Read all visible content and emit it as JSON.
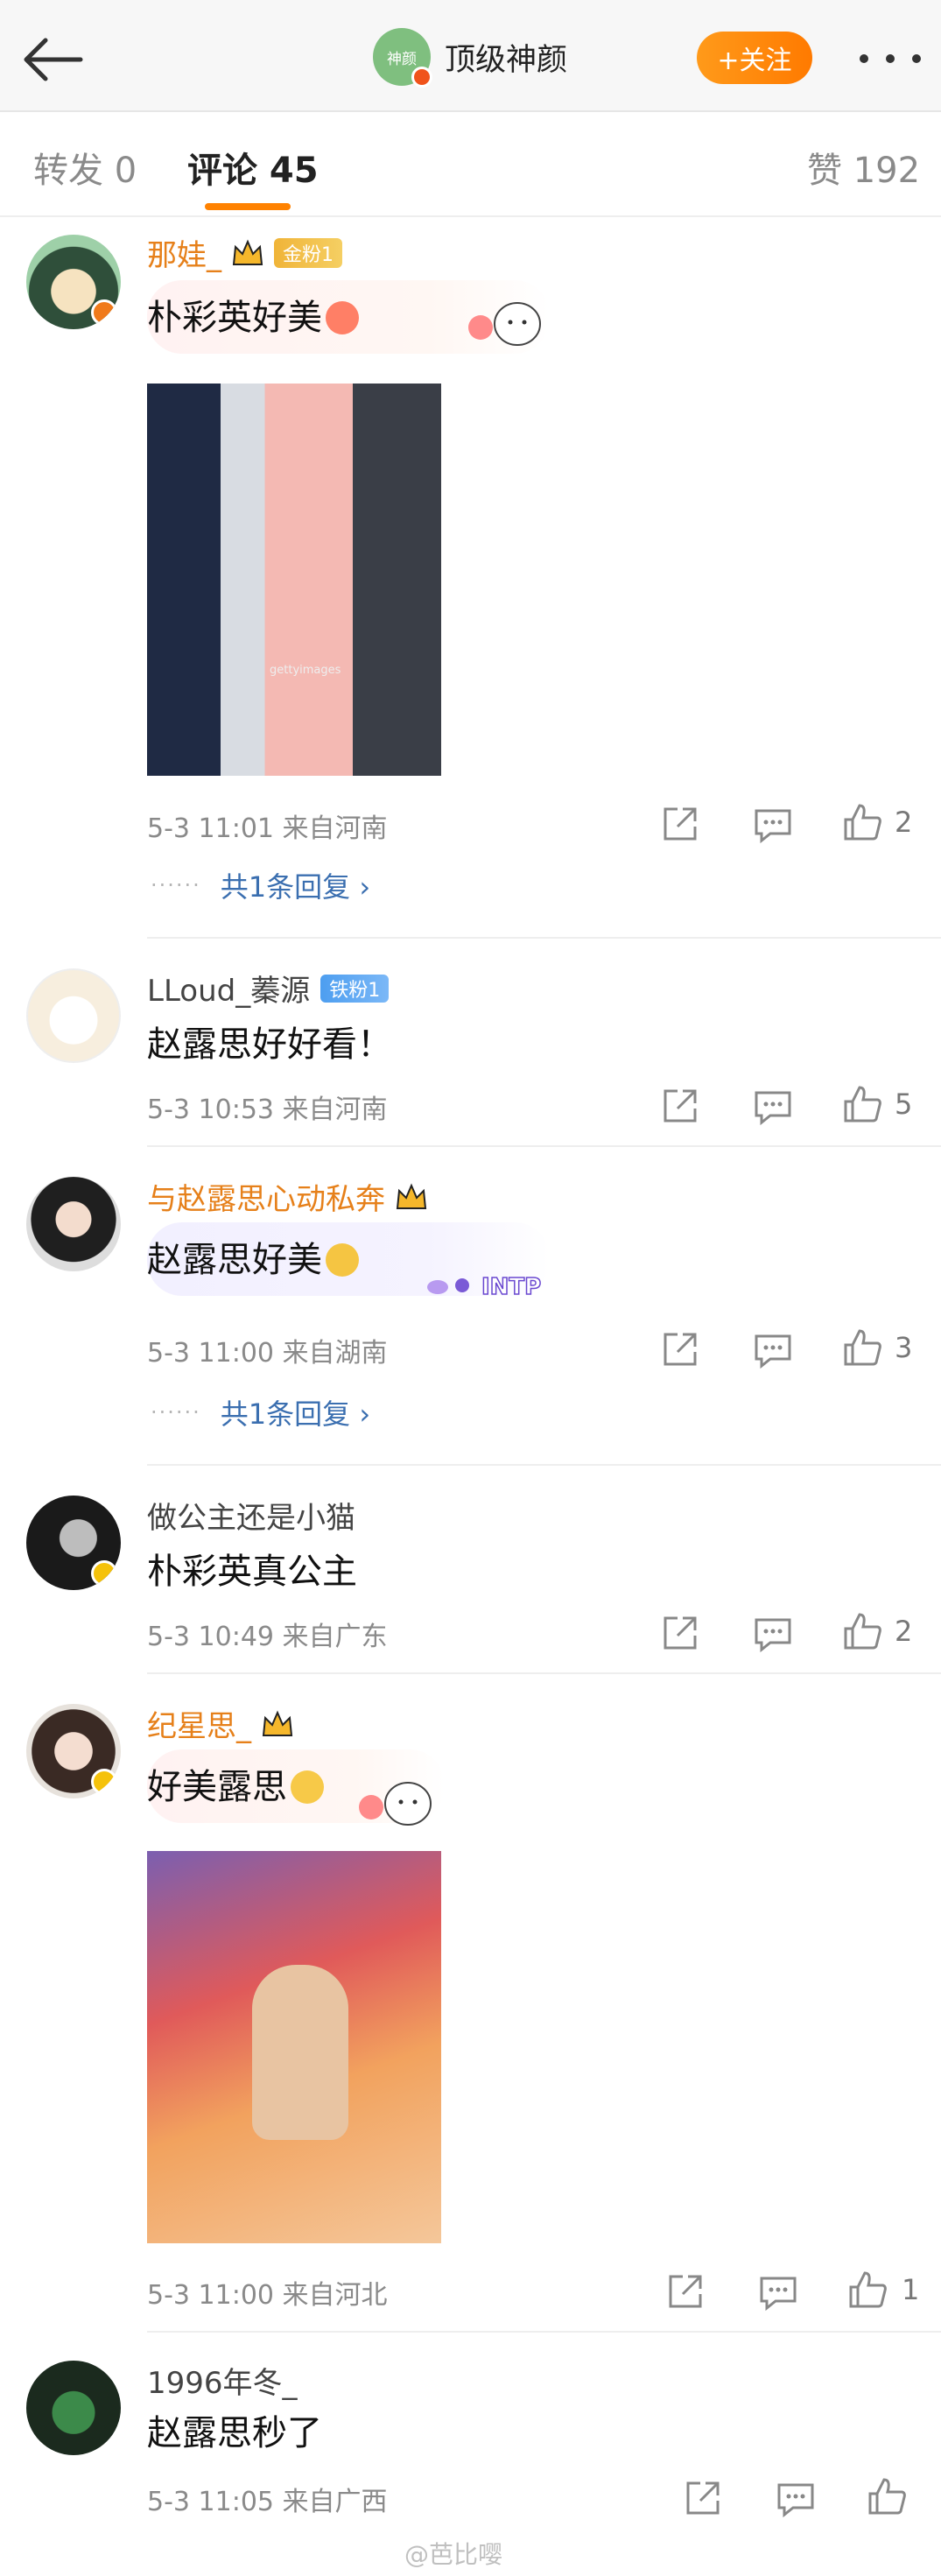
{
  "header": {
    "account_avatar_text": "神颜",
    "account_name": "顶级神颜",
    "follow_label": "+关注"
  },
  "tabs": {
    "reposts": "转发 0",
    "comments": "评论 45",
    "likes": "赞 192"
  },
  "comments": [
    {
      "username": "那娃_",
      "badge": "金粉1",
      "text": "朴彩英好美",
      "has_image": true,
      "meta": "5-3 11:01  来自河南",
      "like_count": "2",
      "replies": "共1条回复 ›"
    },
    {
      "username": "LLoud_蓁源",
      "badge": "铁粉1",
      "text": "赵露思好好看！",
      "has_image": false,
      "meta": "5-3 10:53  来自河南",
      "like_count": "5"
    },
    {
      "username": "与赵露思心动私奔",
      "text": "赵露思好美",
      "has_image": false,
      "meta": "5-3 11:00  来自湖南",
      "like_count": "3",
      "replies": "共1条回复 ›",
      "bubble_tag": "INTP"
    },
    {
      "username": "做公主还是小猫",
      "text": "朴彩英真公主",
      "has_image": false,
      "meta": "5-3 10:49  来自广东",
      "like_count": "2"
    },
    {
      "username": "纪星思_",
      "text": "好美露思",
      "has_image": true,
      "meta": "5-3 11:00  来自河北",
      "like_count": "1"
    },
    {
      "username": "1996年冬_",
      "text": "赵露思秒了",
      "has_image": false,
      "meta": "5-3 11:05  来自广西",
      "like_count": ""
    }
  ],
  "image_caption": "gettyimages",
  "watermark": "@芭比嘤",
  "colors": {
    "accent": "#ff8200",
    "link": "#3b6fb0",
    "vip_name": "#e6801a"
  }
}
